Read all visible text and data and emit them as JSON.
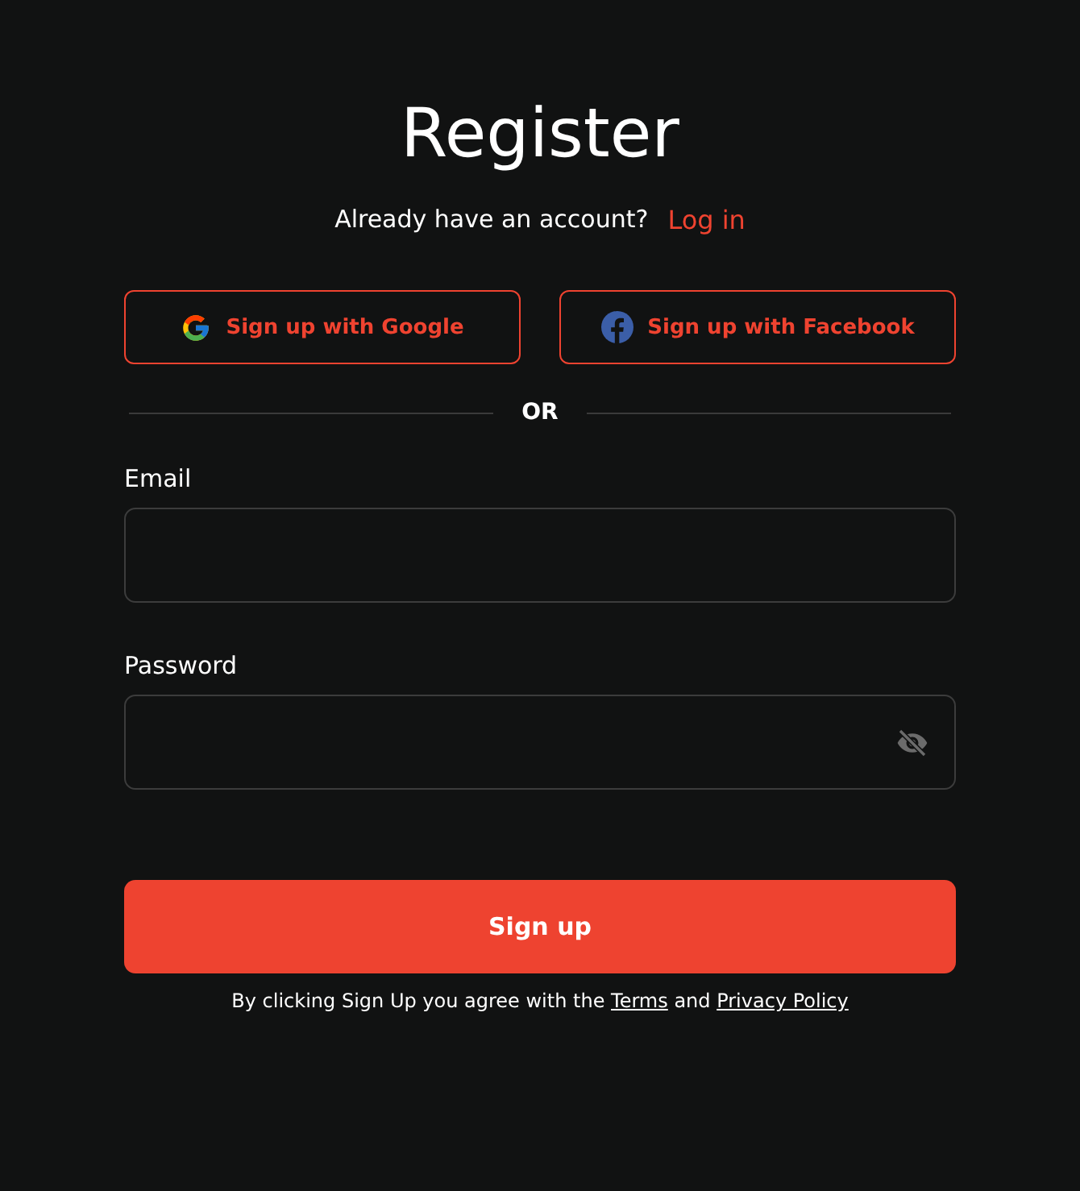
{
  "title": "Register",
  "login_prompt": {
    "text": "Already have an account?",
    "link": "Log in"
  },
  "social_buttons": [
    {
      "kind": "google",
      "label": "Sign up with Google"
    },
    {
      "kind": "facebook",
      "label": "Sign up with Facebook"
    }
  ],
  "divider": "OR",
  "fields": [
    {
      "kind": "email",
      "label": "Email"
    },
    {
      "kind": "password",
      "label": "Password",
      "reveal": false
    }
  ],
  "submit": "Sign up",
  "legal": {
    "text": "By clicking Sign Up you agree with the",
    "terms": "Terms",
    "joiner": "and",
    "privacy": "Privacy Policy"
  }
}
